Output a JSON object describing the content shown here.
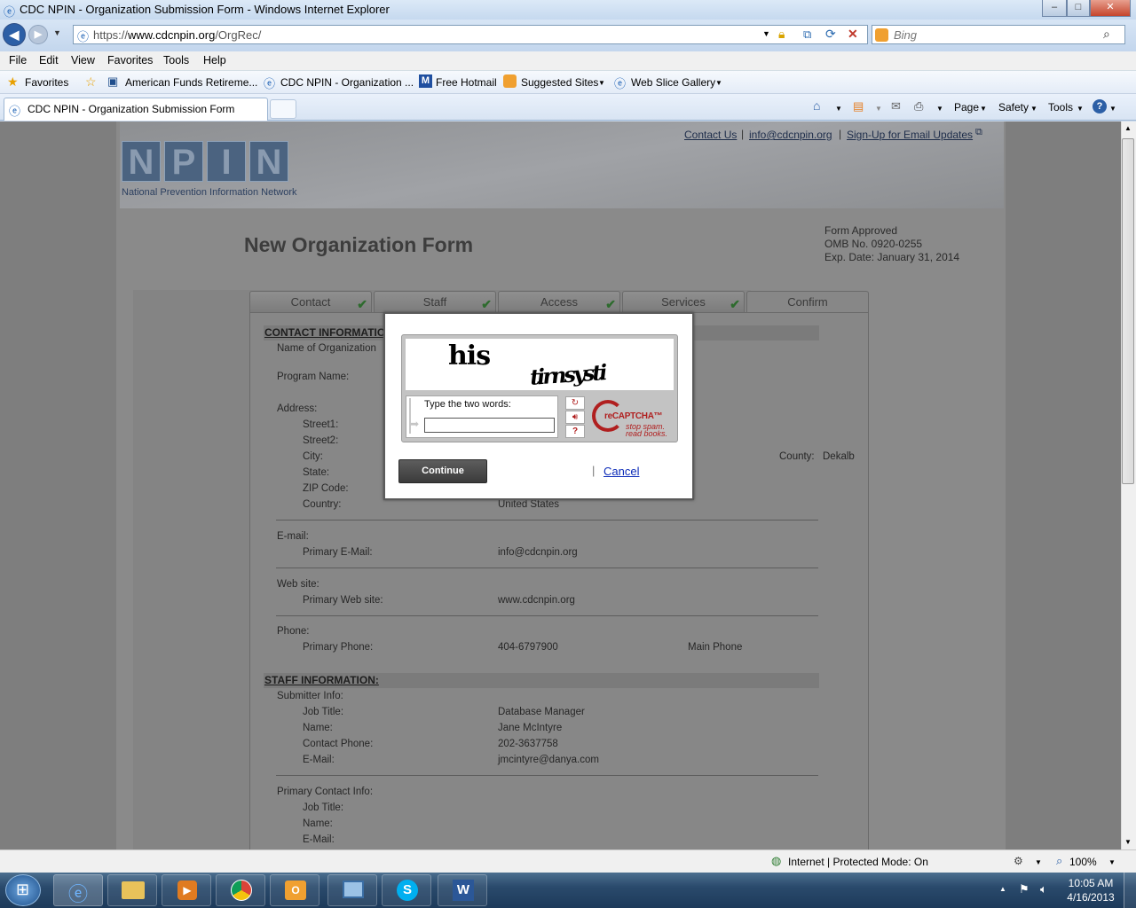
{
  "window": {
    "title": "CDC NPIN - Organization Submission Form - Windows Internet Explorer",
    "min": "–",
    "max": "□",
    "close": "✕"
  },
  "address": {
    "url_scheme": "https://",
    "url_host": "www.cdcnpin.org",
    "url_path": "/OrgRec/",
    "search_placeholder": "Bing"
  },
  "menu": [
    "File",
    "Edit",
    "View",
    "Favorites",
    "Tools",
    "Help"
  ],
  "favorites_bar": {
    "favorites": "Favorites",
    "items": [
      "American Funds Retireme...",
      "CDC NPIN - Organization ...",
      "Free Hotmail",
      "Suggested Sites",
      "Web Slice Gallery"
    ]
  },
  "tabs": {
    "active": "CDC NPIN - Organization Submission Form"
  },
  "command_bar": [
    "Page",
    "Safety",
    "Tools"
  ],
  "site": {
    "logo_letters": [
      "N",
      "P",
      "I",
      "N"
    ],
    "logo_tagline": "National Prevention Information Network",
    "links": [
      "Contact Us",
      "info@cdcnpin.org",
      "Sign-Up for Email Updates"
    ],
    "page_title": "New Organization Form",
    "approval": [
      "Form Approved",
      "OMB No. 0920-0255",
      "Exp. Date: January 31, 2014"
    ],
    "steps": [
      "Contact",
      "Staff",
      "Access",
      "Services",
      "Confirm"
    ],
    "contact_section": "CONTACT INFORMATION",
    "name_of_org": "Name of Organization",
    "program_name": "Program Name:",
    "address_label": "Address:",
    "address_fields": [
      "Street1:",
      "Street2:",
      "City:",
      "State:",
      "ZIP Code:",
      "Country:"
    ],
    "country_value": "United States",
    "county_label": "County:",
    "county_value": "Dekalb",
    "email_label": "E-mail:",
    "primary_email_label": "Primary E-Mail:",
    "primary_email_value": "info@cdcnpin.org",
    "website_label": "Web site:",
    "primary_website_label": "Primary Web site:",
    "primary_website_value": "www.cdcnpin.org",
    "phone_label": "Phone:",
    "primary_phone_label": "Primary Phone:",
    "primary_phone_value": "404-6797900",
    "phone_type": "Main Phone",
    "staff_section": "STAFF INFORMATION:",
    "submitter_label": "Submitter Info:",
    "submitter": [
      {
        "label": "Job Title:",
        "value": "Database Manager"
      },
      {
        "label": "Name:",
        "value": "Jane McIntyre"
      },
      {
        "label": "Contact Phone:",
        "value": "202-3637758"
      },
      {
        "label": "E-Mail:",
        "value": "jmcintyre@danya.com"
      }
    ],
    "primary_contact_label": "Primary Contact Info:",
    "primary_contact_fields": [
      "Job Title:",
      "Name:",
      "E-Mail:"
    ]
  },
  "modal": {
    "captcha_word1": "his",
    "captcha_word2": "tirnsysti",
    "instruction": "Type the two words:",
    "input_value": "",
    "recaptcha_brand": "reCAPTCHA™",
    "recaptcha_tag1": "stop spam.",
    "recaptcha_tag2": "read books.",
    "continue_label": "Continue",
    "cancel_label": "Cancel"
  },
  "status": {
    "zone": "Internet | Protected Mode: On",
    "zoom": "100%"
  },
  "taskbar": {
    "time": "10:05 AM",
    "date": "4/16/2013"
  },
  "colors": {
    "link": "#0c2bb8",
    "recaptcha_red": "#b01f1f",
    "logo_blue": "#4b6380"
  }
}
